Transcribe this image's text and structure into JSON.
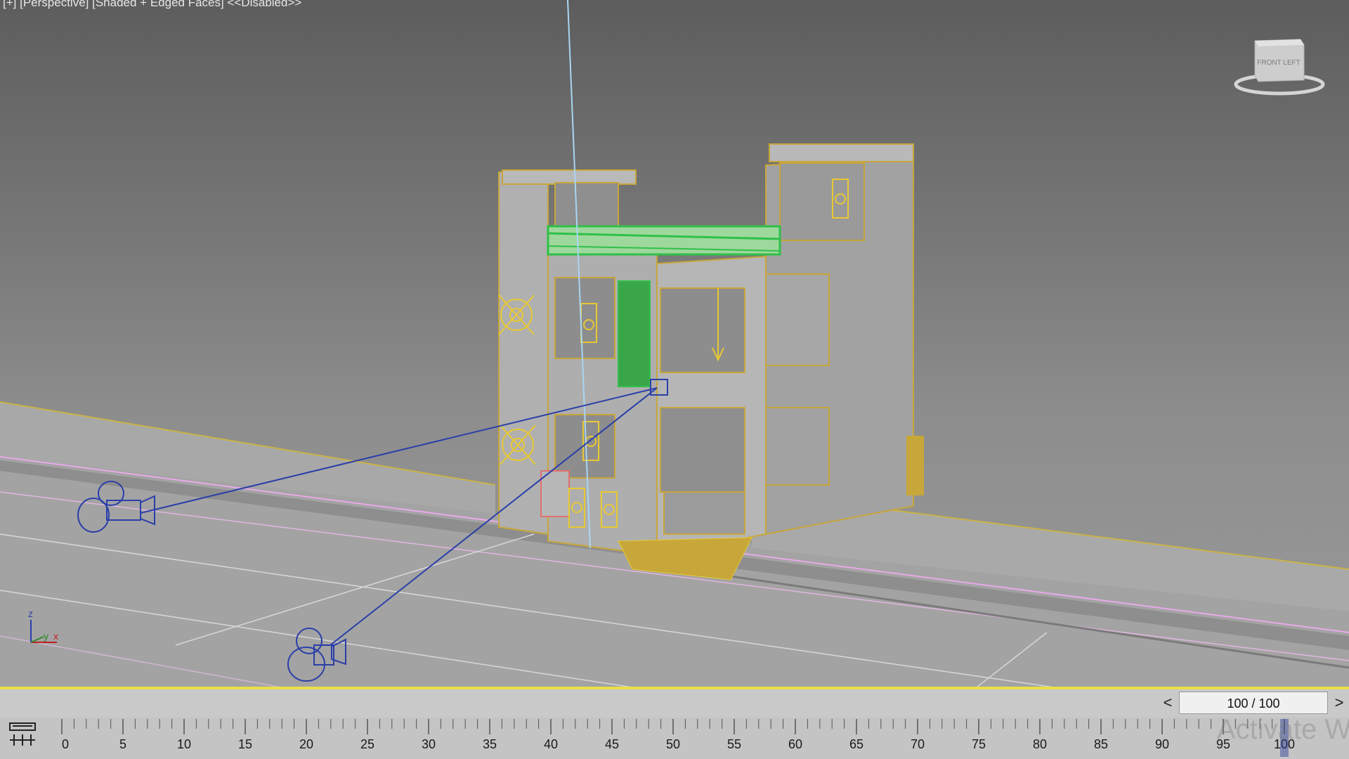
{
  "viewport": {
    "label_plus": "[+]",
    "label_view": "[Perspective]",
    "label_shading": "[Shaded + Edged Faces]",
    "label_status": "<<Disabled>>",
    "background_top": "#5d5d5d",
    "background_bottom": "#9a9a9a",
    "active_border_color": "#e8e04a"
  },
  "viewcube": {
    "face_label": "FRONT LEFT",
    "icon": "viewcube-icon"
  },
  "scene": {
    "selection_color": "#e8c832",
    "camera_color": "#2a3fa8",
    "foliage_color": "#2fc048",
    "building": "building-model-icon",
    "cameras": [
      "camera-icon",
      "camera-icon"
    ],
    "lights": [
      "light-icon",
      "light-icon",
      "light-icon",
      "light-icon",
      "light-icon",
      "light-icon",
      "light-icon"
    ]
  },
  "axis_tripod": {
    "z": "z",
    "y": "y",
    "x": "x"
  },
  "time_slider": {
    "prev_label": "<",
    "frame_label": "100 / 100",
    "next_label": ">",
    "current_frame": 100,
    "total_frames": 100
  },
  "track_bar": {
    "tick_labels": [
      "0",
      "5",
      "10",
      "15",
      "20",
      "25",
      "30",
      "35",
      "40",
      "45",
      "50",
      "55",
      "60",
      "65",
      "70",
      "75",
      "80",
      "85",
      "90",
      "95",
      "100"
    ],
    "curve_editor_icon": "mini-curve-editor-icon"
  },
  "watermark": {
    "text": "Activate Win"
  }
}
